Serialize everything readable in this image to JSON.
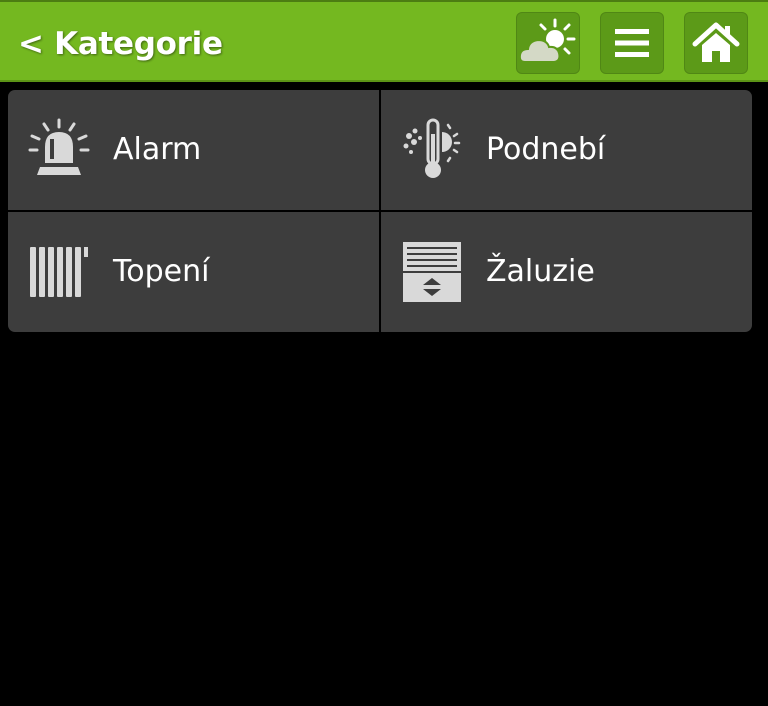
{
  "header": {
    "back_label": "< Kategorie",
    "buttons": [
      {
        "icon": "weather-icon"
      },
      {
        "icon": "menu-icon"
      },
      {
        "icon": "home-icon"
      }
    ]
  },
  "categories": [
    {
      "label": "Alarm",
      "icon": "alarm-siren-icon"
    },
    {
      "label": "Podnebí",
      "icon": "climate-thermometer-icon"
    },
    {
      "label": "Topení",
      "icon": "radiator-icon"
    },
    {
      "label": "Žaluzie",
      "icon": "blinds-icon"
    }
  ],
  "colors": {
    "header_bg": "#74b820",
    "header_button_bg": "#5c9a18",
    "tile_bg": "#3d3d3d",
    "icon": "#d9d9d9",
    "background": "#000000"
  }
}
